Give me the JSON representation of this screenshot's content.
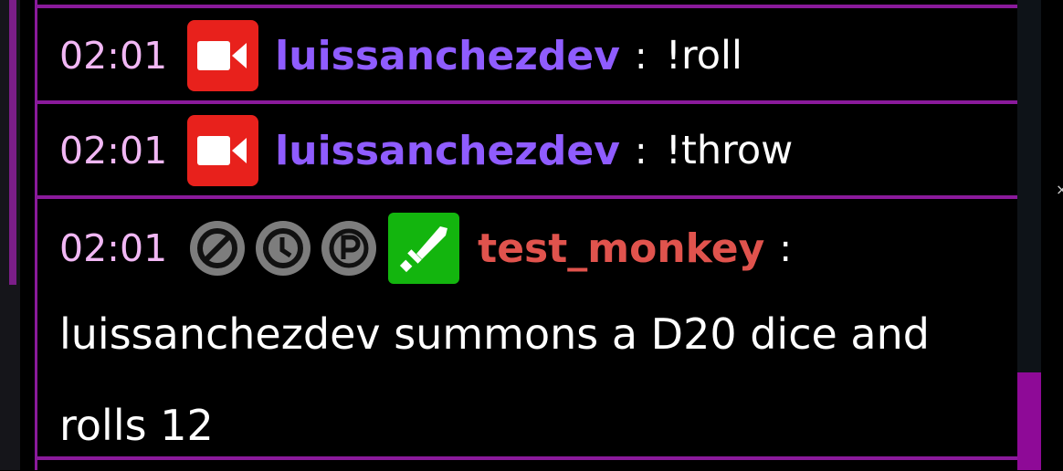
{
  "chat": {
    "messages": [
      {
        "time": "02:01",
        "badges": [
          "broadcaster-icon"
        ],
        "username": "luissanchezdev",
        "username_color": "#8f5cff",
        "separator": ":",
        "text": "!roll"
      },
      {
        "time": "02:01",
        "badges": [
          "broadcaster-icon"
        ],
        "username": "luissanchezdev",
        "username_color": "#8f5cff",
        "separator": ":",
        "text": "!throw"
      },
      {
        "time": "02:01",
        "badges": [
          "ban-icon",
          "clock-icon",
          "p-badge-icon",
          "moderator-sword-icon"
        ],
        "username": "test_monkey",
        "username_color": "#e0534d",
        "separator": ":",
        "text": "luissanchezdev summons a D20 dice and rolls 12"
      }
    ]
  },
  "colors": {
    "accent": "#8a1a9b",
    "timestamp": "#f1b7f4",
    "broadcaster_badge": "#e8211c",
    "moderator_badge": "#13b50e"
  }
}
